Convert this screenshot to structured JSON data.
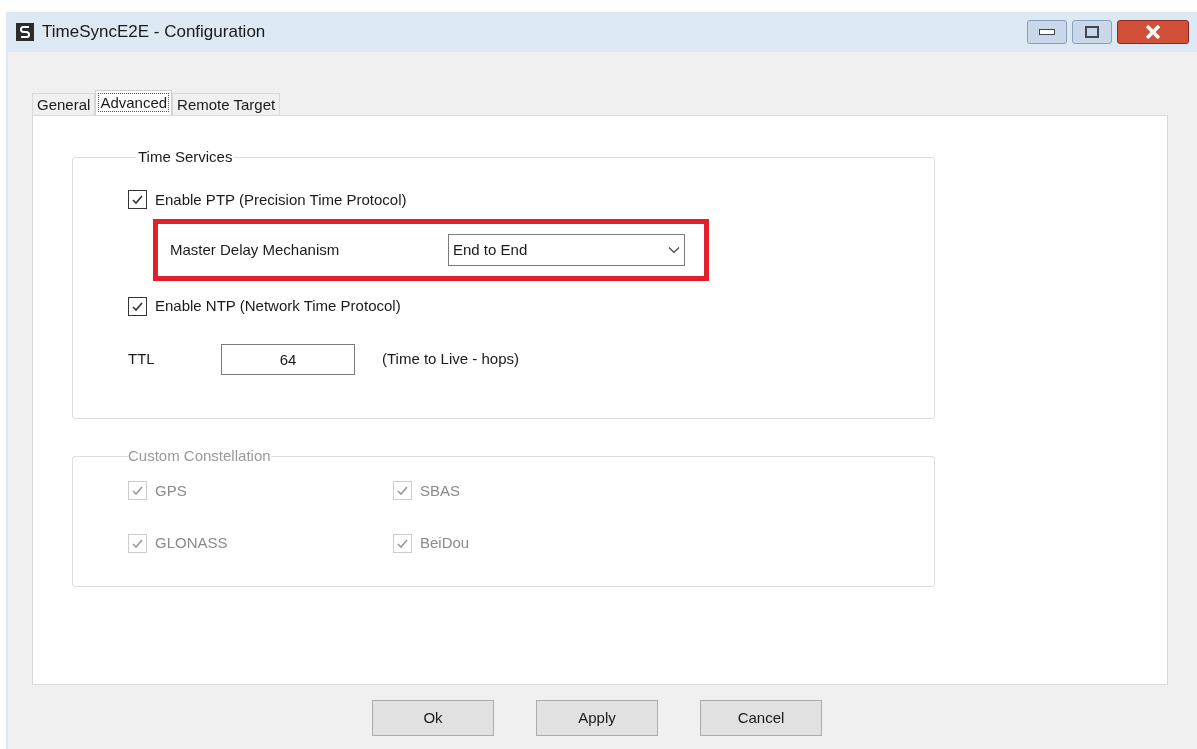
{
  "window": {
    "title": "TimeSyncE2E - Configuration"
  },
  "tabs": [
    {
      "label": "General",
      "selected": false
    },
    {
      "label": "Advanced",
      "selected": true
    },
    {
      "label": "Remote Target",
      "selected": false
    }
  ],
  "time_services": {
    "title": "Time Services",
    "ptp": {
      "label": "Enable PTP (Precision Time Protocol)",
      "checked": true
    },
    "master_delay": {
      "label": "Master Delay Mechanism",
      "value": "End to End",
      "highlighted": true
    },
    "ntp": {
      "label": "Enable NTP (Network Time Protocol)",
      "checked": true
    },
    "ttl": {
      "label": "TTL",
      "value": "64",
      "hint": "(Time to Live - hops)"
    }
  },
  "custom_constellation": {
    "title": "Custom Constellation",
    "disabled": true,
    "items": [
      {
        "label": "GPS",
        "checked": true
      },
      {
        "label": "SBAS",
        "checked": true
      },
      {
        "label": "GLONASS",
        "checked": true
      },
      {
        "label": "BeiDou",
        "checked": true
      }
    ]
  },
  "buttons": [
    {
      "label": "Ok"
    },
    {
      "label": "Apply"
    },
    {
      "label": "Cancel"
    }
  ]
}
